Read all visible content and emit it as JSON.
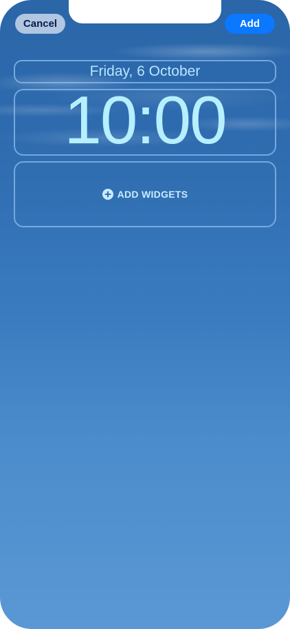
{
  "header": {
    "cancel_label": "Cancel",
    "add_label": "Add"
  },
  "lock_screen": {
    "date": "Friday, 6 October",
    "time": "10:00",
    "add_widgets_label": "ADD WIDGETS",
    "add_widgets_icon": "plus-circle-icon"
  },
  "colors": {
    "accent": "#0a78ff",
    "widget_text": "#b6efff"
  }
}
